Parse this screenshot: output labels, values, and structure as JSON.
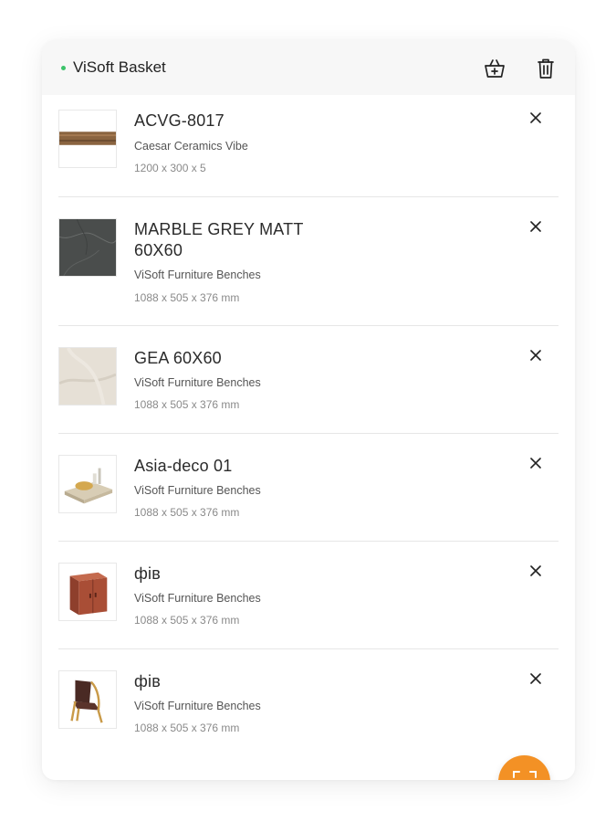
{
  "header": {
    "title": "ViSoft Basket",
    "status_color": "#3cc36a",
    "basket_icon": "basket-add-icon",
    "trash_icon": "trash-icon"
  },
  "items": [
    {
      "name": "ACVG-8017",
      "subtitle": "Caesar Ceramics Vibe",
      "dimensions": "1200 x 300 x 5",
      "thumb": "wood-plank"
    },
    {
      "name": "MARBLE GREY MATT 60X60",
      "subtitle": "ViSoft Furniture Benches",
      "dimensions": "1088 x 505 x 376 mm",
      "thumb": "dark-marble"
    },
    {
      "name": "GEA 60X60",
      "subtitle": "ViSoft Furniture Benches",
      "dimensions": "1088 x 505 x 376 mm",
      "thumb": "beige-marble"
    },
    {
      "name": "Asia-deco 01",
      "subtitle": "ViSoft Furniture Benches",
      "dimensions": "1088 x 505 x 376 mm",
      "thumb": "bath-tray"
    },
    {
      "name": "фів",
      "subtitle": "ViSoft Furniture Benches",
      "dimensions": "1088 x 505 x 376 mm",
      "thumb": "cabinet"
    },
    {
      "name": "фів",
      "subtitle": "ViSoft Furniture Benches",
      "dimensions": "1088 x 505 x 376 mm",
      "thumb": "chair"
    }
  ],
  "fab": {
    "icon": "scan-icon",
    "color": "#f39125"
  }
}
